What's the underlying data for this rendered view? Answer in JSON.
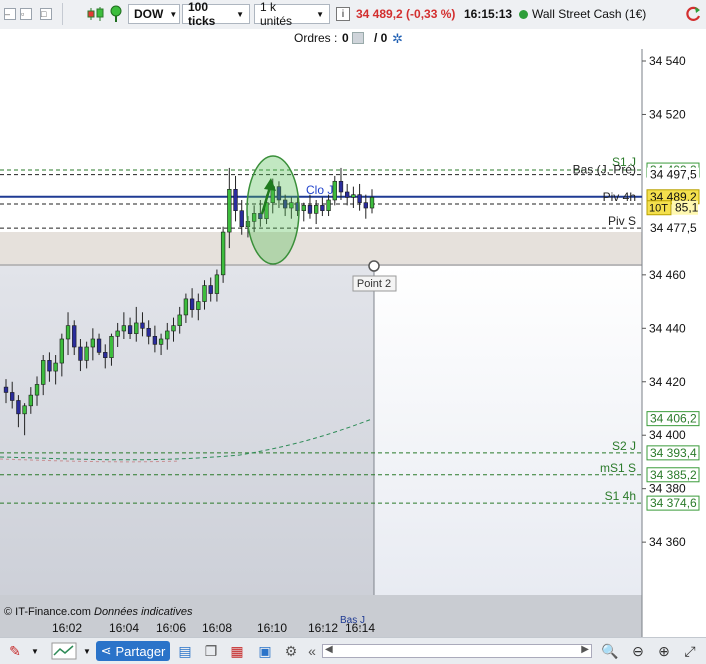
{
  "toolbar": {
    "instrument": "DOW",
    "period": "100 ticks",
    "size": "1 k unités",
    "price_quote": "34 489,2 (-0,33 %)",
    "time": "16:15:13",
    "market_name": "Wall Street Cash (1€)",
    "icons": [
      "minimize-icon",
      "maximize-icon",
      "close-icon",
      "candles-icon",
      "pin-icon",
      "info-icon",
      "status-dot-icon",
      "refresh-icon"
    ]
  },
  "orders": {
    "label": "Ordres :",
    "count1": "0",
    "count2": "/ 0"
  },
  "chart_data": {
    "type": "candlestick",
    "title": "",
    "ylim": [
      34340,
      34545
    ],
    "x_ticks": [
      "16:02",
      "16:04",
      "16:06",
      "16:08",
      "16:10",
      "16:12",
      "16:14"
    ],
    "y_ticks": [
      "34 540",
      "34 520",
      "34 460",
      "34 440",
      "34 420",
      "34 400",
      "34 380",
      "34 360"
    ],
    "price_labels": [
      {
        "value": 34499.2,
        "text": "34 499,2",
        "style": "green-box"
      },
      {
        "value": 34497.5,
        "text": "34 497,5",
        "style": "plain"
      },
      {
        "value": 34489.2,
        "text": "34 489,2",
        "style": "current"
      },
      {
        "value": 34485.1,
        "text": "85,1",
        "style": "yellow"
      },
      {
        "value": 34477.5,
        "text": "34 477,5",
        "style": "plain"
      },
      {
        "value": 34406.2,
        "text": "34 406,2",
        "style": "green-box"
      },
      {
        "value": 34393.4,
        "text": "34 393,4",
        "style": "green-box"
      },
      {
        "value": 34385.2,
        "text": "34 385,2",
        "style": "green-box"
      },
      {
        "value": 34374.6,
        "text": "34 374,6",
        "style": "green-box"
      }
    ],
    "level_lines": [
      {
        "name": "S1 J",
        "value": 34499.2,
        "color": "#2a7a2a"
      },
      {
        "name": "Bas (J, Pré)",
        "value": 34497.5,
        "color": "#222222"
      },
      {
        "name": "Clo J",
        "value": 34489.2,
        "color": "#2244cc"
      },
      {
        "name": "Piv 4h",
        "value": 34486.5,
        "color": "#222222"
      },
      {
        "name": "Piv S",
        "value": 34477.5,
        "color": "#222222"
      },
      {
        "name": "S2 J",
        "value": 34393.4,
        "color": "#2a7a2a"
      },
      {
        "name": "mS1 S",
        "value": 34385.2,
        "color": "#2a7a2a"
      },
      {
        "name": "S1 4h",
        "value": 34374.6,
        "color": "#2a7a2a"
      }
    ],
    "tag_10T": "10T",
    "point_label": "Point 2",
    "bottom_partial_label": "Bas J",
    "candles": [
      [
        34418,
        34421,
        34412,
        34416
      ],
      [
        34416,
        34420,
        34410,
        34413
      ],
      [
        34413,
        34415,
        34403,
        34408
      ],
      [
        34408,
        34412,
        34400,
        34411
      ],
      [
        34411,
        34418,
        34408,
        34415
      ],
      [
        34415,
        34422,
        34411,
        34419
      ],
      [
        34419,
        34430,
        34415,
        34428
      ],
      [
        34428,
        34431,
        34420,
        34424
      ],
      [
        34424,
        34430,
        34419,
        34427
      ],
      [
        34427,
        34438,
        34422,
        34436
      ],
      [
        34436,
        34446,
        34430,
        34441
      ],
      [
        34441,
        34443,
        34430,
        34433
      ],
      [
        34433,
        34436,
        34424,
        34428
      ],
      [
        34428,
        34435,
        34425,
        34433
      ],
      [
        34433,
        34440,
        34428,
        34436
      ],
      [
        34436,
        34438,
        34430,
        34431
      ],
      [
        34431,
        34434,
        34425,
        34429
      ],
      [
        34429,
        34438,
        34426,
        34437
      ],
      [
        34437,
        34442,
        34433,
        34439
      ],
      [
        34439,
        34446,
        34436,
        34441
      ],
      [
        34441,
        34444,
        34436,
        34438
      ],
      [
        34438,
        34448,
        34435,
        34442
      ],
      [
        34442,
        34446,
        34437,
        34440
      ],
      [
        34440,
        34443,
        34434,
        34437
      ],
      [
        34437,
        34441,
        34431,
        34434
      ],
      [
        34434,
        34438,
        34430,
        34436
      ],
      [
        34436,
        34442,
        34432,
        34439
      ],
      [
        34439,
        34444,
        34435,
        34441
      ],
      [
        34441,
        34448,
        34438,
        34445
      ],
      [
        34445,
        34453,
        34442,
        34451
      ],
      [
        34451,
        34455,
        34444,
        34447
      ],
      [
        34447,
        34453,
        34443,
        34450
      ],
      [
        34450,
        34458,
        34447,
        34456
      ],
      [
        34456,
        34459,
        34450,
        34453
      ],
      [
        34453,
        34462,
        34450,
        34460
      ],
      [
        34460,
        34478,
        34457,
        34476
      ],
      [
        34476,
        34500,
        34470,
        34492
      ],
      [
        34492,
        34497,
        34480,
        34484
      ],
      [
        34484,
        34488,
        34475,
        34478
      ],
      [
        34478,
        34482,
        34474,
        34480
      ],
      [
        34480,
        34486,
        34476,
        34483
      ],
      [
        34483,
        34488,
        34478,
        34481
      ],
      [
        34481,
        34490,
        34479,
        34487
      ],
      [
        34487,
        34496,
        34483,
        34493
      ],
      [
        34493,
        34495,
        34485,
        34488
      ],
      [
        34488,
        34490,
        34482,
        34485
      ],
      [
        34485,
        34489,
        34481,
        34487
      ],
      [
        34487,
        34489,
        34482,
        34484
      ],
      [
        34484,
        34487,
        34480,
        34486
      ],
      [
        34486,
        34490,
        34481,
        34483
      ],
      [
        34483,
        34488,
        34479,
        34486
      ],
      [
        34486,
        34489,
        34482,
        34484
      ],
      [
        34484,
        34490,
        34482,
        34488
      ],
      [
        34488,
        34497,
        34486,
        34495
      ],
      [
        34495,
        34500,
        34488,
        34491
      ],
      [
        34491,
        34494,
        34486,
        34489
      ],
      [
        34489,
        34493,
        34485,
        34490
      ],
      [
        34490,
        34494,
        34484,
        34487
      ],
      [
        34487,
        34490,
        34481,
        34485
      ],
      [
        34485,
        34492,
        34483,
        34489
      ]
    ]
  },
  "bottom": {
    "copyright": "© IT-Finance.com",
    "note": "Données indicatives",
    "share_label": "Partager",
    "icons": [
      "drawing-tools-icon",
      "indicators-icon",
      "share-icon",
      "comment-icon",
      "copy-icon",
      "export-icon",
      "screenshot-icon",
      "settings-icon",
      "scroll-left-icon",
      "scroll-right-icon",
      "zoom-fit-icon",
      "zoom-out-icon",
      "zoom-in-icon",
      "fullscreen-icon"
    ]
  },
  "colors": {
    "up": "#3dbd3d",
    "down": "#2a2c9c",
    "current_price_line": "#1f3a93",
    "shaded_zone": "#e6e1dc"
  }
}
